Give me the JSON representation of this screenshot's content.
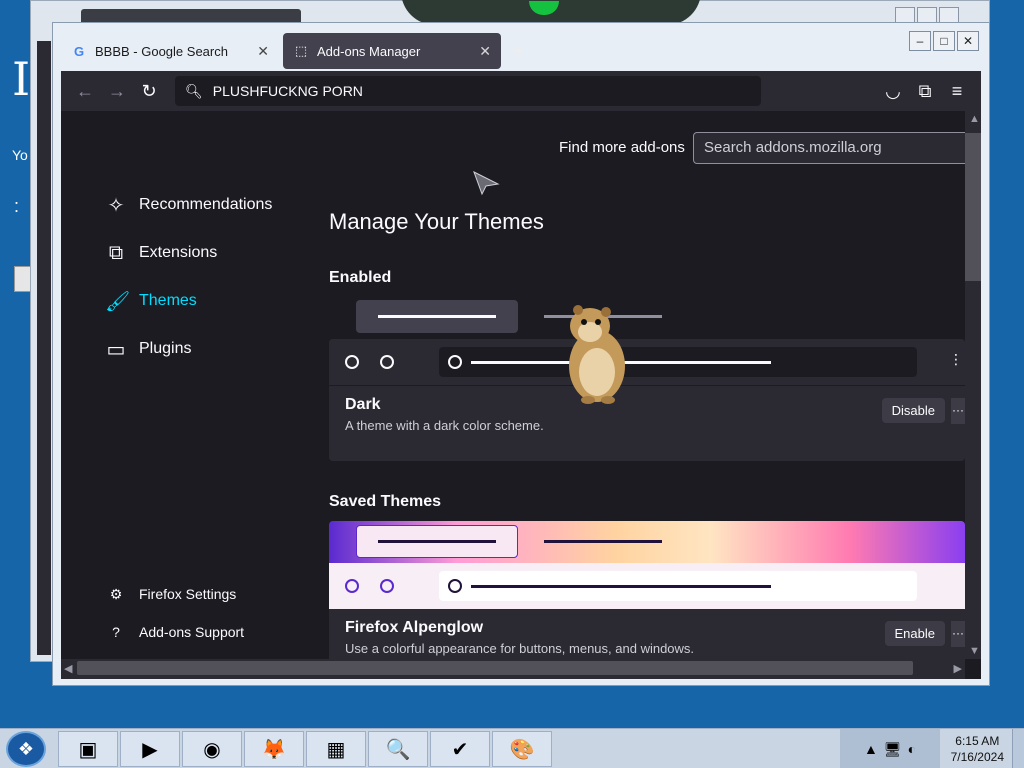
{
  "desktop": {
    "letter": "I",
    "text_yo": "Yo",
    "text_dot": ":"
  },
  "window": {
    "tabs": [
      {
        "label": "BBBB - Google Search",
        "icon": "G"
      },
      {
        "label": "Add-ons Manager",
        "icon": "⬚"
      }
    ],
    "new_tab_label": "+",
    "controls": {
      "minimize": "–",
      "maximize": "□",
      "close": "✕"
    }
  },
  "toolbar": {
    "back": "←",
    "forward": "→",
    "reload": "↻",
    "url": "PLUSHFUCKNG PORN",
    "pocket": "◡",
    "extensions": "⧉",
    "menu": "≡"
  },
  "addons": {
    "find_more": "Find more add-ons",
    "search_placeholder": "Search addons.mozilla.org",
    "sidebar": [
      {
        "label": "Recommendations",
        "icon": "✧"
      },
      {
        "label": "Extensions",
        "icon": "⧉"
      },
      {
        "label": "Themes",
        "icon": "🖌"
      },
      {
        "label": "Plugins",
        "icon": "▭"
      }
    ],
    "sidebar_bottom": [
      {
        "label": "Firefox Settings",
        "icon": "⚙"
      },
      {
        "label": "Add-ons Support",
        "icon": "?"
      }
    ],
    "title": "Manage Your Themes",
    "enabled_heading": "Enabled",
    "saved_heading": "Saved Themes",
    "enabled_theme": {
      "name": "Dark",
      "description": "A theme with a dark color scheme.",
      "button": "Disable",
      "more": "···"
    },
    "saved_theme": {
      "name": "Firefox Alpenglow",
      "description": "Use a colorful appearance for buttons, menus, and windows.",
      "button": "Enable",
      "more": "···"
    }
  },
  "taskbar": {
    "start_icon": "❖",
    "apps": [
      "▣",
      "▶",
      "◉",
      "🦊",
      "▦",
      "🔍",
      "✔",
      "🎨"
    ],
    "tray_icons": [
      "▲",
      "🖥",
      "◐"
    ],
    "time": "6:15 AM",
    "date": "7/16/2024"
  }
}
